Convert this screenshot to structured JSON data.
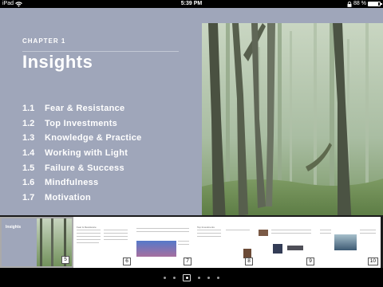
{
  "status_bar": {
    "device": "iPad",
    "time": "5:39 PM",
    "battery": "88 %",
    "battery_level": 0.88
  },
  "chapter": {
    "label": "CHAPTER 1",
    "title": "Insights",
    "sections": [
      {
        "number": "1.1",
        "title": "Fear & Resistance"
      },
      {
        "number": "1.2",
        "title": "Top Investments"
      },
      {
        "number": "1.3",
        "title": "Knowledge & Practice"
      },
      {
        "number": "1.4",
        "title": "Working with Light"
      },
      {
        "number": "1.5",
        "title": "Failure & Success"
      },
      {
        "number": "1.6",
        "title": "Mindfulness"
      },
      {
        "number": "1.7",
        "title": "Motivation"
      }
    ]
  },
  "thumbnails": {
    "current_title": "Insights",
    "headings": [
      "Fear & Resistance",
      "Top Investments"
    ],
    "pages": [
      "5",
      "6",
      "7",
      "8",
      "9",
      "10"
    ]
  },
  "page_indicator": {
    "count": 6,
    "current_index": 2
  }
}
